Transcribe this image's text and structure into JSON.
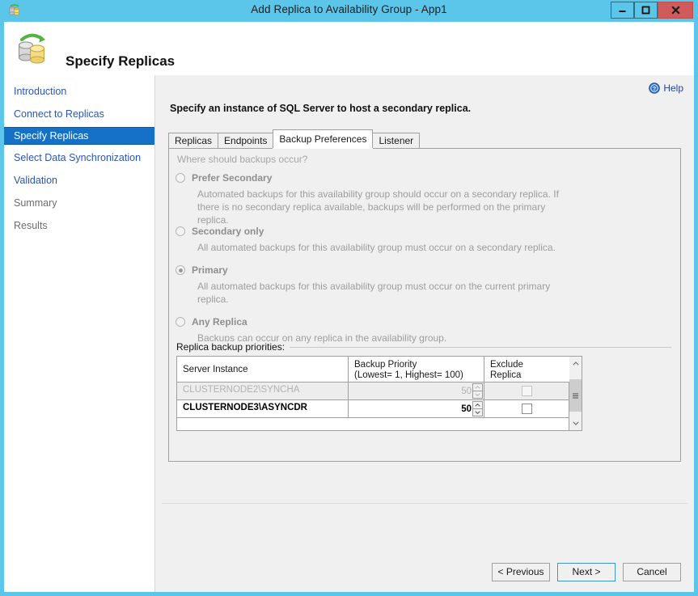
{
  "window": {
    "title": "Add Replica to Availability Group - App1",
    "app_icon": "database-replica-icon",
    "controls": {
      "minimize": "minimize-icon",
      "maximize": "maximize-icon",
      "close": "close-icon"
    }
  },
  "header": {
    "title": "Specify Replicas",
    "icon": "database-sync-icon"
  },
  "sidebar": {
    "items": [
      {
        "label": "Introduction",
        "state": "link"
      },
      {
        "label": "Connect to Replicas",
        "state": "link"
      },
      {
        "label": "Specify Replicas",
        "state": "active"
      },
      {
        "label": "Select Data Synchronization",
        "state": "link"
      },
      {
        "label": "Validation",
        "state": "link"
      },
      {
        "label": "Summary",
        "state": "disabled"
      },
      {
        "label": "Results",
        "state": "disabled"
      }
    ]
  },
  "help": {
    "label": "Help",
    "icon": "help-circle-icon"
  },
  "main": {
    "heading": "Specify an instance of SQL Server to host a secondary replica.",
    "tabs": [
      {
        "label": "Replicas",
        "active": false
      },
      {
        "label": "Endpoints",
        "active": false
      },
      {
        "label": "Backup Preferences",
        "active": true
      },
      {
        "label": "Listener",
        "active": false
      }
    ],
    "question": "Where should backups occur?",
    "options": [
      {
        "label": "Prefer Secondary",
        "checked": false,
        "description": "Automated backups for this availability group should occur on a secondary replica. If there is no secondary replica available, backups will be performed on the primary replica."
      },
      {
        "label": "Secondary only",
        "checked": false,
        "description": "All automated backups for this availability group must occur on a secondary replica."
      },
      {
        "label": "Primary",
        "checked": true,
        "description": "All automated backups for this availability group must occur on the current primary replica."
      },
      {
        "label": "Any Replica",
        "checked": false,
        "description": "Backups can occur on any replica in the availability group."
      }
    ],
    "group": {
      "legend": "Replica backup priorities:",
      "columns": [
        "Server Instance",
        "Backup Priority\n(Lowest= 1, Highest= 100)",
        "Exclude\nReplica"
      ],
      "column_priority_line1": "Backup Priority",
      "column_priority_line2": "(Lowest= 1, Highest= 100)",
      "column_exclude_line1": "Exclude",
      "column_exclude_line2": "Replica",
      "rows": [
        {
          "server": "CLUSTERNODE2\\SYNCHA",
          "priority": "50",
          "exclude": false,
          "enabled": false
        },
        {
          "server": "CLUSTERNODE3\\ASYNCDR",
          "priority": "50",
          "exclude": false,
          "enabled": true
        }
      ]
    }
  },
  "footer": {
    "previous": "< Previous",
    "next": "Next >",
    "cancel": "Cancel"
  },
  "colors": {
    "titlebar": "#5bc5ea",
    "accent_selected": "#1571c8",
    "link": "#2b56b0",
    "close_button": "#d15b5b",
    "panel": "#f0f0f0"
  }
}
